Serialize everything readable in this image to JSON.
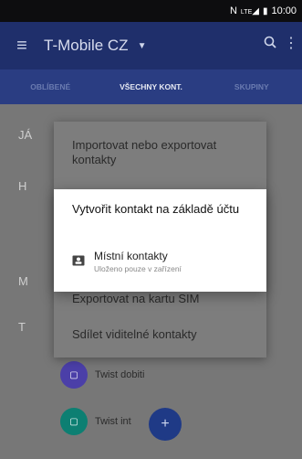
{
  "status": {
    "network": "N",
    "signal_label": "LTE",
    "time": "10:00"
  },
  "appbar": {
    "title": "T-Mobile CZ"
  },
  "tabs": [
    "OBLÍBENÉ",
    "VŠECHNY KONT.",
    "SKUPINY"
  ],
  "sections": {
    "me": "JÁ",
    "h": "H",
    "m": "M",
    "t": "T"
  },
  "contacts": [
    {
      "name": "Twist dobiti",
      "color": "#4b3fa8"
    },
    {
      "name": "Twist int",
      "color": "#0d7f72"
    }
  ],
  "menu": {
    "import_export": "Importovat nebo exportovat kontakty",
    "export_sim": "Exportovat na kartu SIM",
    "share_visible": "Sdílet viditelné kontakty"
  },
  "dialog": {
    "title": "Vytvořit kontakt na základě účtu",
    "option_main": "Místní kontakty",
    "option_sub": "Uloženo pouze v zařízení"
  },
  "colors": {
    "appbar": "#1f2f6b",
    "tabs": "#2a3d82",
    "fab": "#1f3a86"
  }
}
